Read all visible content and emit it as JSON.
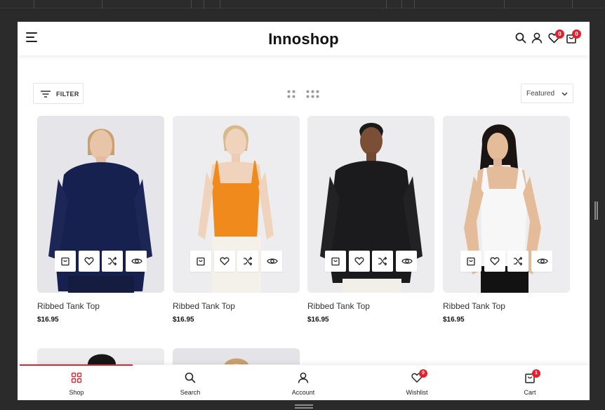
{
  "app": {
    "brand": "Innoshop"
  },
  "header": {
    "wishlist_count": "0",
    "cart_count": "0",
    "icons": [
      "menu-icon",
      "search-icon",
      "user-icon",
      "heart-icon",
      "bag-icon"
    ]
  },
  "toolbar": {
    "filter_label": "FILTER",
    "sort_label": "Featured"
  },
  "products": [
    {
      "name": "Ribbed Tank Top",
      "price": "$16.95"
    },
    {
      "name": "Ribbed Tank Top",
      "price": "$16.95"
    },
    {
      "name": "Ribbed Tank Top",
      "price": "$16.95"
    },
    {
      "name": "Ribbed Tank Top",
      "price": "$16.95"
    }
  ],
  "bottom_nav": {
    "items": [
      {
        "label": "Shop",
        "icon": "grid-icon",
        "active": true
      },
      {
        "label": "Search",
        "icon": "search-icon"
      },
      {
        "label": "Account",
        "icon": "user-icon"
      },
      {
        "label": "Wishlist",
        "icon": "heart-icon",
        "badge": "0"
      },
      {
        "label": "Cart",
        "icon": "bag-icon",
        "badge": "1"
      }
    ]
  },
  "colors": {
    "accent": "#e3202e",
    "active_bar": "#d42a33",
    "card_bg": "#ececee"
  }
}
